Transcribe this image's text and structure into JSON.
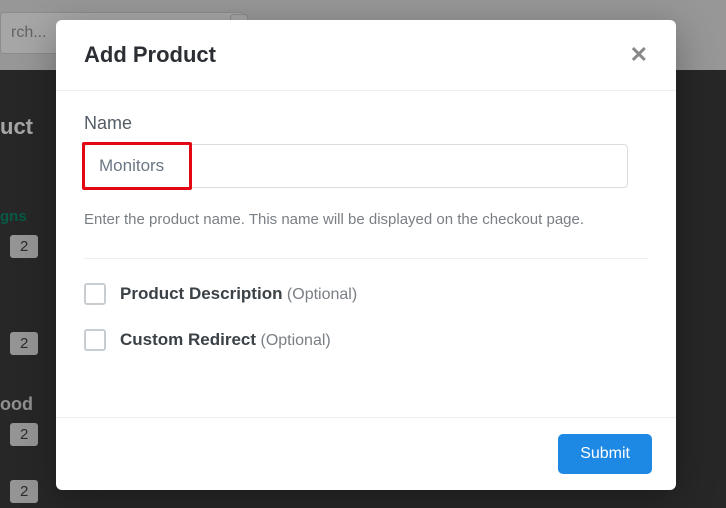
{
  "background": {
    "search_placeholder": "rch...",
    "side_title": "uct",
    "side_sub1": "gns",
    "side_sub2": "ood",
    "badge": "2"
  },
  "modal": {
    "title": "Add Product",
    "close": "✕",
    "name_label": "Name",
    "name_value": "Monitors",
    "help_text": "Enter the product name. This name will be displayed on the checkout page.",
    "opt_desc_label": "Product Description",
    "opt_redirect_label": "Custom Redirect",
    "optional_suffix": "(Optional)",
    "submit": "Submit"
  }
}
